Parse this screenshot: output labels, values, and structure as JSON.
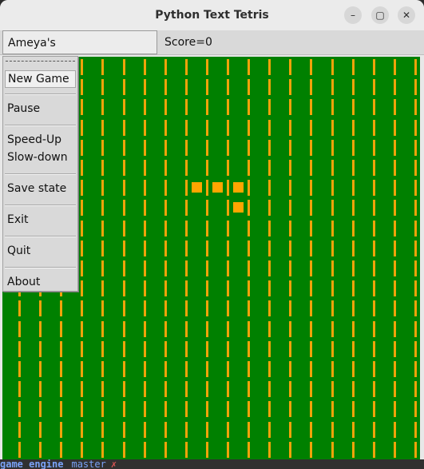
{
  "window": {
    "title": "Python Text Tetris",
    "controls": {
      "minimize": "–",
      "maximize": "▢",
      "close": "✕"
    }
  },
  "menubar": {
    "game_menu": "Ameya's EXtendedTETRIckS",
    "score": "Score=0"
  },
  "dropdown": {
    "items": [
      "New Game",
      "Pause",
      "Speed-Up",
      "Slow-down",
      "Save state",
      "Exit",
      "Quit",
      "About"
    ]
  },
  "board": {
    "background": "#008000",
    "stripe_color": "#f0a30a",
    "block_color": "#ffa500"
  },
  "terminal": {
    "left": "game engine",
    "branch": "master",
    "mark": "✗"
  }
}
